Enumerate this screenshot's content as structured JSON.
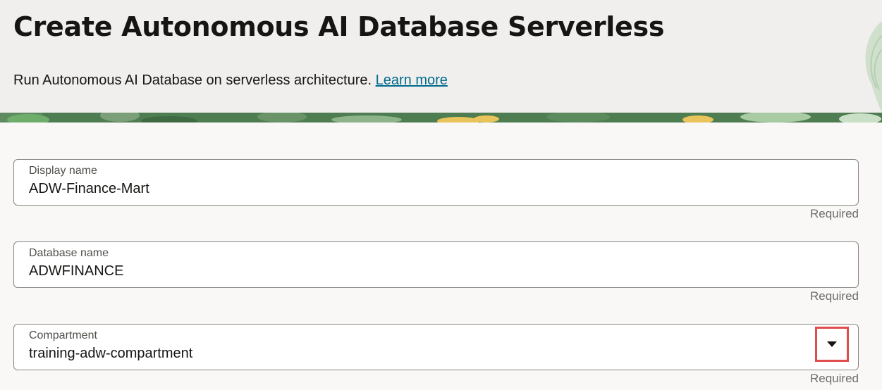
{
  "header": {
    "title": "Create Autonomous AI Database Serverless",
    "subtitle": "Run Autonomous AI Database on serverless architecture.",
    "learn_more": "Learn more"
  },
  "form": {
    "display_name": {
      "label": "Display name",
      "value": "ADW-Finance-Mart",
      "hint": "Required"
    },
    "database_name": {
      "label": "Database name",
      "value": "ADWFINANCE",
      "hint": "Required"
    },
    "compartment": {
      "label": "Compartment",
      "value": "training-adw-compartment",
      "hint": "Required",
      "icon": "chevron-down-icon"
    }
  },
  "colors": {
    "header_bg": "#f1efed",
    "page_bg": "#f9f8f6",
    "link": "#006b8f",
    "highlight": "#e04b4b",
    "banner_green": "#4a7a4e"
  }
}
